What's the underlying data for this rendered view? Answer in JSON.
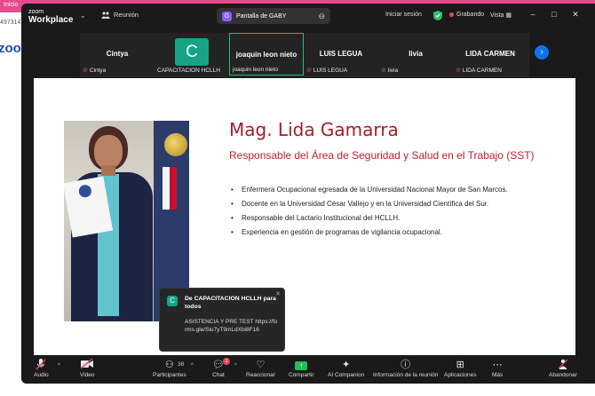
{
  "background": {
    "browser_tab": "Inicio",
    "url_fragment": "497314",
    "logo_fragment": "zoo"
  },
  "titlebar": {
    "app_name_top": "zoom",
    "app_name_bottom": "Workplace",
    "meeting_label": "Reunión",
    "share_tab_badge": "G",
    "share_tab_label": "Pantalla de GABY",
    "signin_label": "Iniciar sesión",
    "recording_label": "Grabando",
    "view_label": "Vista",
    "colors": {
      "active_border": "#2dbd6e",
      "recording": "#e5484d",
      "accent": "#0e72ed"
    }
  },
  "participants": [
    {
      "display": "Cintya",
      "label": "Cintya",
      "muted": true
    },
    {
      "display": "C",
      "label": "CAPACITACION HCLLH",
      "muted": false
    },
    {
      "display": "joaquin leon nieto",
      "label": "joaquin leon nieto",
      "muted": false,
      "active": true
    },
    {
      "display": "LUIS LEGUA",
      "label": "LUIS LEGUA",
      "muted": true
    },
    {
      "display": "livia",
      "label": "livia",
      "muted": true
    },
    {
      "display": "LIDA CARMEN",
      "label": "LIDA CARMEN",
      "muted": true
    }
  ],
  "slide": {
    "title": "Mag. Lida Gamarra",
    "subtitle": "Responsable del Área de Seguridad y Salud en el Trabajo (SST)",
    "bullets": [
      "Enfermera Ocupacional egresada de la Universidad Nacional Mayor de San Marcos.",
      "Docente en la Universidad César Vallejo y en la Universidad Científica del Sur.",
      "Responsable del Lactario Institucional del HCLLH.",
      "Experiencia en gestión de programas de vigilancia ocupacional."
    ]
  },
  "chat_toast": {
    "avatar": "C",
    "header": "De CAPACITACION HCLLH para todos",
    "message": "ASISTENCIA Y PRE TEST https://forms.gle/Siu7yT9mLdXbi8F16"
  },
  "toolbar": {
    "audio": "Audio",
    "video": "Video",
    "participants": "Participantes",
    "participants_count": "38",
    "chat": "Chat",
    "chat_badge": "1",
    "react": "Reaccionar",
    "share": "Compartir",
    "companion": "AI Companion",
    "meeting_info": "Información de la reunión",
    "apps": "Aplicaciones",
    "more": "Más",
    "leave": "Abandonar"
  }
}
